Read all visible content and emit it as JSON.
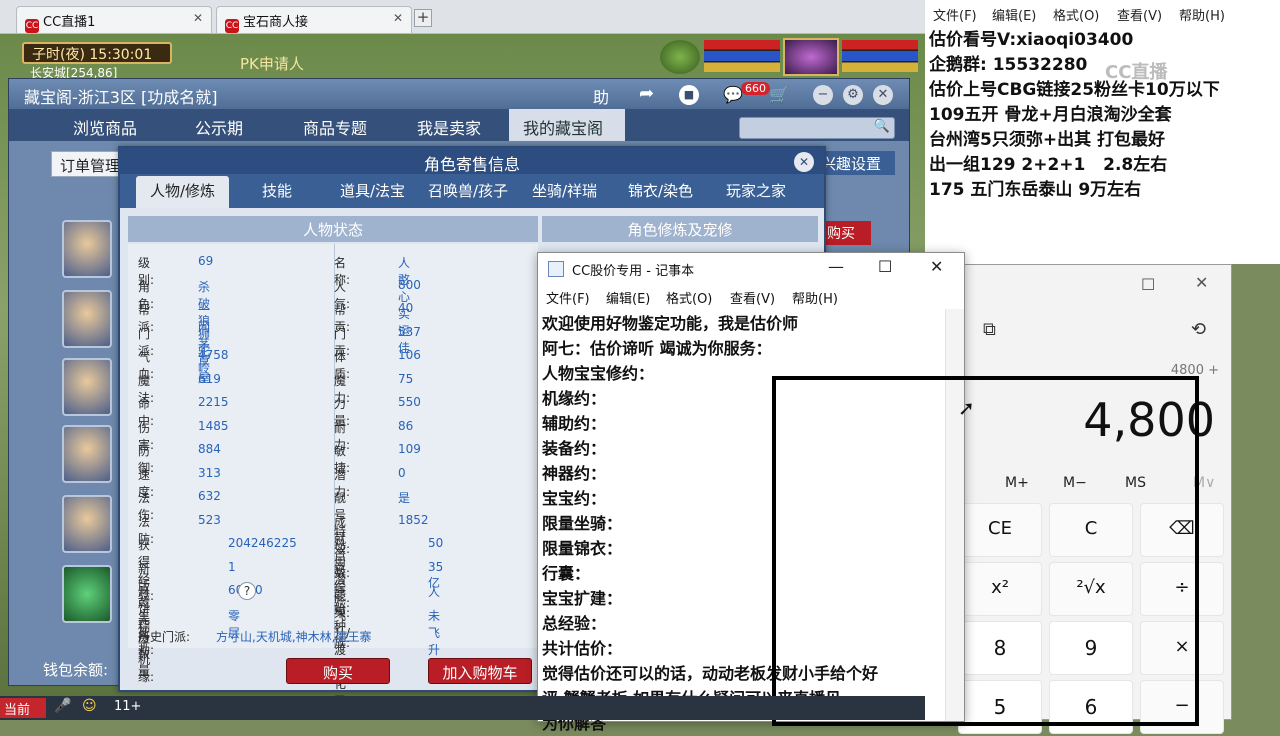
{
  "browser": {
    "tabs": [
      {
        "title": "CC直播1",
        "icon": "cc-logo-icon"
      },
      {
        "title": "宝石商人接",
        "icon": "cc-logo-icon"
      }
    ],
    "newtab_label": "+"
  },
  "game": {
    "clock": "子时(夜) 15:30:01",
    "location": "长安城[254,86]",
    "pk_label": "PK申请人",
    "taskbar": {
      "current": "当前",
      "level": "11+"
    }
  },
  "cbg": {
    "title": "藏宝阁-浙江3区 [功成名就]",
    "help_label": "助",
    "cart_badge": "660",
    "nav": [
      "浏览商品",
      "公示期",
      "商品专题",
      "我是卖家",
      "我的藏宝阁"
    ],
    "order_label": "订单管理",
    "interest_label": "兴趣设置",
    "buy_side": "购买",
    "wallet_label": "钱包余额:"
  },
  "role": {
    "title": "角色寄售信息",
    "tabs": [
      "人物/修炼",
      "技能",
      "道具/法宝",
      "召唤兽/孩子",
      "坐骑/祥瑞",
      "锦衣/染色",
      "玩家之家"
    ],
    "sec_left": "人物状态",
    "sec_right": "角色修炼及宠修",
    "rows": [
      [
        {
          "l": "级别:",
          "v": "69"
        },
        {
          "l": "名称:",
          "v": "人憨心实运佳"
        }
      ],
      [
        {
          "l": "角色:",
          "v": "杀破狼"
        },
        {
          "l": "人气:",
          "v": "800"
        }
      ],
      [
        {
          "l": "帮派:",
          "v": "一间茅草屋"
        },
        {
          "l": "帮贡:",
          "v": "40"
        }
      ],
      [
        {
          "l": "门派:",
          "v": "狮驼岭"
        },
        {
          "l": "门贡:",
          "v": "537"
        }
      ],
      [
        {
          "l": "气血:",
          "v": "4758"
        },
        {
          "l": "体质:",
          "v": "106"
        }
      ],
      [
        {
          "l": "魔法:",
          "v": "619"
        },
        {
          "l": "魔力:",
          "v": "75"
        }
      ],
      [
        {
          "l": "命中:",
          "v": "2215"
        },
        {
          "l": "力量:",
          "v": "550"
        }
      ],
      [
        {
          "l": "伤害:",
          "v": "1485"
        },
        {
          "l": "耐力:",
          "v": "86"
        }
      ],
      [
        {
          "l": "防御:",
          "v": "884"
        },
        {
          "l": "敏捷:",
          "v": "109"
        }
      ],
      [
        {
          "l": "速度:",
          "v": "313"
        },
        {
          "l": "潜力:",
          "v": "0"
        }
      ],
      [
        {
          "l": "法伤:",
          "v": "632"
        },
        {
          "l": "靓号特效:",
          "v": "是"
        }
      ],
      [
        {
          "l": "法防:",
          "v": "523"
        },
        {
          "l": "成就点数:",
          "v": "1852"
        }
      ],
      [
        {
          "l": "获得经验:",
          "v": "204246225"
        },
        {
          "l": "已用潜能果:",
          "v": "50"
        }
      ],
      [
        {
          "l": "新版乾元丹数量",
          "v": "1"
        },
        {
          "l": "总经验:",
          "v": "35亿"
        }
      ],
      [
        {
          "l": "月饼粽子机缘:",
          "v": "60/60"
        },
        {
          "l": "原始种族:",
          "v": "人"
        }
      ],
      [
        {
          "l": "生死劫:",
          "v": "零层"
        },
        {
          "l": "飞升/渡劫/化圣:",
          "v": "未飞升"
        }
      ]
    ],
    "history_label": "历史门派:",
    "history_value": "方寸山,天机城,神木林,魔王寨",
    "buy_button": "购买",
    "cart_button": "加入购物车"
  },
  "notepad": {
    "title": "CC股价专用 - 记事本",
    "menu": [
      "文件(F)",
      "编辑(E)",
      "格式(O)",
      "查看(V)",
      "帮助(H)"
    ],
    "lines": [
      "欢迎使用好物鉴定功能，我是估价师",
      "阿七：估价谛听 竭诚为你服务：",
      "人物宝宝修约：",
      "机缘约：",
      "辅助约：",
      "装备约：",
      "神器约：",
      "宝宝约：",
      "限量坐骑：",
      "限量锦衣：",
      "行囊：",
      "宝宝扩建：",
      "总经验：",
      "共计估价：",
      "觉得估价还可以的话，动动老板发财小手给个好",
      "评 蟹蟹老板 如果有什么疑问可以来直播见 ——",
      "为你解答"
    ]
  },
  "notes": {
    "menu": [
      "文件(F)",
      "编辑(E)",
      "格式(O)",
      "查看(V)",
      "帮助(H)"
    ],
    "lines": [
      "估价看号V:xiaoqi03400",
      "企鹅群: 15532280",
      "估价上号CBG链接25粉丝卡10万以下",
      "109五开 骨龙+月白浪淘沙全套",
      "台州湾5只须弥+出其 打包最好",
      "出一组129 2+2+1   2.8左右",
      "175 五门东岳泰山 9万左右"
    ],
    "watermark": "CC直播"
  },
  "calculator": {
    "expression": "4800 +",
    "display": "4,800",
    "memory": [
      "M+",
      "M−",
      "MS",
      "M∨"
    ],
    "keys": [
      [
        "CE",
        "C",
        "⌫"
      ],
      [
        "x²",
        "²√x",
        "÷"
      ],
      [
        "8",
        "9",
        "×"
      ],
      [
        "5",
        "6",
        "−"
      ]
    ]
  }
}
